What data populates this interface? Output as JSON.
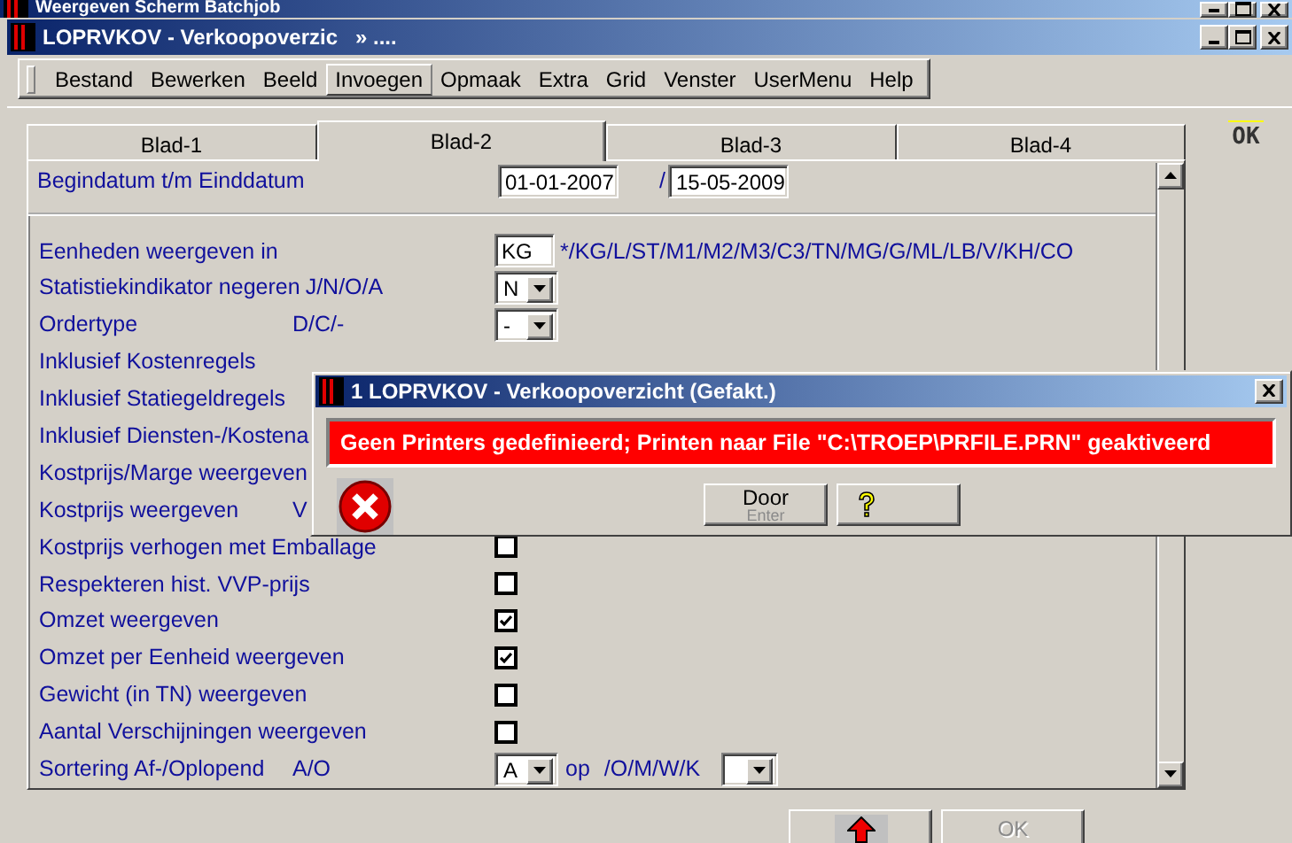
{
  "outer_window": {
    "title": "Weergeven Scherm Batchjob"
  },
  "window": {
    "title": "LOPRVKOV - Verkoopoverzic",
    "title_suffix": "»  ...."
  },
  "menu": [
    {
      "label": "Bestand",
      "selected": false
    },
    {
      "label": "Bewerken",
      "selected": false
    },
    {
      "label": "Beeld",
      "selected": false
    },
    {
      "label": "Invoegen",
      "selected": true
    },
    {
      "label": "Opmaak",
      "selected": false
    },
    {
      "label": "Extra",
      "selected": false
    },
    {
      "label": "Grid",
      "selected": false
    },
    {
      "label": "Venster",
      "selected": false
    },
    {
      "label": "UserMenu",
      "selected": false
    },
    {
      "label": "Help",
      "selected": false
    }
  ],
  "tabs": [
    {
      "label": "Blad-1",
      "selected": false
    },
    {
      "label": "Blad-2",
      "selected": true
    },
    {
      "label": "Blad-3",
      "selected": false
    },
    {
      "label": "Blad-4",
      "selected": false
    }
  ],
  "side_button": "OK",
  "date_row": {
    "label": "Begindatum t/m Einddatum",
    "from": "01-01-2007",
    "separator": "/",
    "to": "15-05-2009"
  },
  "rows": [
    {
      "kind": "text-field",
      "label": "Eenheden weergeven in",
      "value": "KG",
      "after": "*/KG/L/ST/M1/M2/M3/C3/TN/MG/G/ML/LB/V/KH/CO"
    },
    {
      "kind": "dropdown",
      "label": "Statistiekindikator negeren",
      "hint": "J/N/O/A",
      "value": "N"
    },
    {
      "kind": "dropdown",
      "label": "Ordertype",
      "hint": "D/C/-",
      "value": "-"
    },
    {
      "kind": "label",
      "label": "Inklusief Kostenregels"
    },
    {
      "kind": "label",
      "label": "Inklusief Statiegeldregels"
    },
    {
      "kind": "label",
      "label": "Inklusief Diensten-/Kostena"
    },
    {
      "kind": "label",
      "label": "Kostprijs/Marge weergeven"
    },
    {
      "kind": "label",
      "label": "Kostprijs weergeven",
      "hint": "V"
    },
    {
      "kind": "checkbox",
      "label": "Kostprijs verhogen met Emballage",
      "checked": false
    },
    {
      "kind": "checkbox",
      "label": "Respekteren hist. VVP-prijs",
      "checked": false
    },
    {
      "kind": "checkbox",
      "label": "Omzet weergeven",
      "checked": true
    },
    {
      "kind": "checkbox",
      "label": "Omzet per Eenheid weergeven",
      "checked": true
    },
    {
      "kind": "checkbox",
      "label": "Gewicht (in TN) weergeven",
      "checked": false
    },
    {
      "kind": "checkbox",
      "label": "Aantal Verschijningen weergeven",
      "checked": false
    },
    {
      "kind": "sort",
      "label": "Sortering Af-/Oplopend",
      "hint": "A/O",
      "value": "A",
      "after": "op",
      "after_hint": "/O/M/W/K"
    }
  ],
  "dialog": {
    "title": "1 LOPRVKOV - Verkoopoverzicht (Gefakt.)",
    "message": "Geen Printers gedefinieerd; Printen naar File \"C:\\TROEP\\PRFILE.PRN\" geaktiveerd",
    "buttons": [
      {
        "kind": "text",
        "label": "Door",
        "shortcut": "Enter"
      },
      {
        "kind": "help"
      }
    ]
  },
  "footer_buttons": [
    {
      "kind": "up-arrow",
      "disabled": false
    },
    {
      "kind": "text",
      "label": "OK",
      "disabled": true
    }
  ]
}
